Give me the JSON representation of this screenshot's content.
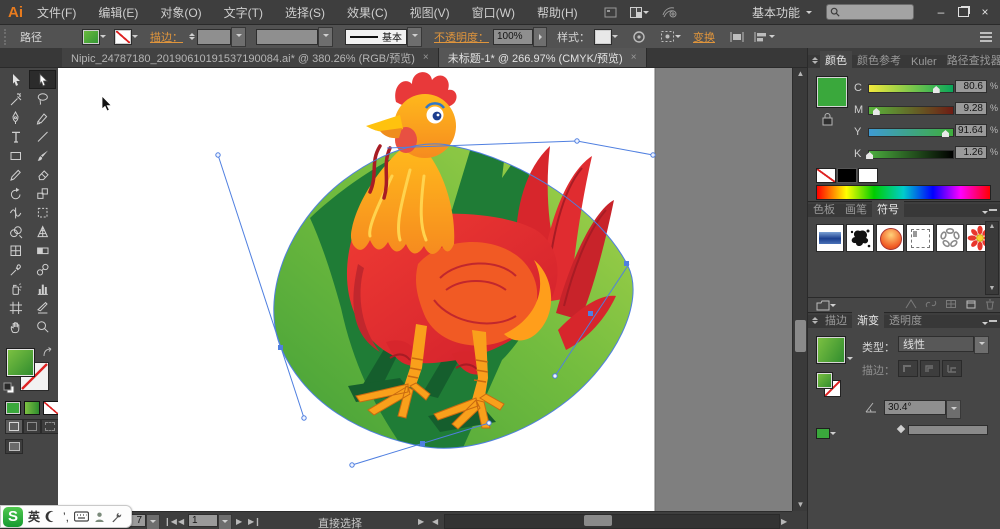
{
  "titlebar": {
    "logo": "Ai",
    "menus": [
      "文件(F)",
      "编辑(E)",
      "对象(O)",
      "文字(T)",
      "选择(S)",
      "效果(C)",
      "视图(V)",
      "窗口(W)",
      "帮助(H)"
    ],
    "workspace": "基本功能",
    "window_controls": {
      "minimize": "–",
      "restore": "restore",
      "close": "×"
    }
  },
  "optionsbar": {
    "context_label": "路径",
    "stroke_link": "描边：",
    "stroke_weight": "",
    "stroke_style": "基本",
    "opacity_link": "不透明度：",
    "opacity_value": "100%",
    "style_label": "样式：",
    "transform_link": "变换"
  },
  "tabs": [
    {
      "title": "Nipic_24787180_20190610191537190084.ai* @ 380.26% (RGB/预览)",
      "close": "×",
      "active": false
    },
    {
      "title": "未标题-1* @ 266.97% (CMYK/预览)",
      "close": "×",
      "active": true
    }
  ],
  "tools": [
    "selection",
    "direct-selection",
    "magic-wand",
    "lasso",
    "pen",
    "blob-brush",
    "type",
    "line-segment",
    "rectangle",
    "paintbrush",
    "pencil",
    "eraser",
    "rotate",
    "scale",
    "width",
    "free-transform",
    "shape-builder",
    "perspective-grid",
    "mesh",
    "gradient",
    "eyedropper",
    "blend",
    "symbol-sprayer",
    "column-graph",
    "artboard",
    "slice",
    "hand",
    "zoom"
  ],
  "active_tool": "direct-selection",
  "color_panel": {
    "tabs": [
      "颜色",
      "颜色参考",
      "Kuler",
      "路径查找器"
    ],
    "active_tab": "颜色",
    "channels": [
      {
        "label": "C",
        "value": "80.6",
        "unit": "%",
        "pos": 80.6
      },
      {
        "label": "M",
        "value": "9.28",
        "unit": "%",
        "pos": 9.28
      },
      {
        "label": "Y",
        "value": "91.64",
        "unit": "%",
        "pos": 91.64
      },
      {
        "label": "K",
        "value": "1.26",
        "unit": "%",
        "pos": 1.26
      }
    ]
  },
  "symbols_panel": {
    "tabs": [
      "色板",
      "画笔",
      "符号"
    ],
    "active_tab": "符号",
    "symbols": [
      "blue-banner",
      "ink-splat",
      "orange-orb",
      "dashed-frame",
      "gray-wreath",
      "red-daisy"
    ]
  },
  "gradient_panel": {
    "tabs": [
      "描边",
      "渐变",
      "透明度"
    ],
    "active_tab": "渐变",
    "type_label": "类型：",
    "type_value": "线性",
    "stroke_label": "描边：",
    "angle_value": "30.4°"
  },
  "statusbar": {
    "zoom_partial": "7",
    "artboard_number": "1",
    "tool_name": "直接选择"
  },
  "ime": {
    "logo": "S",
    "lang": "英",
    "punct": "’,"
  },
  "colors": {
    "ui_accent_link": "#e0953c",
    "selection_blue": "#4f7fe0",
    "current_fill_green": "#3aa83c",
    "gradient_stops": [
      "#7ec242",
      "#2e8b2e"
    ],
    "blob_light_green": "#a9d34b",
    "blob_dark_green": "#1f7c36",
    "rooster_red": "#e8242c",
    "rooster_orange": "#f7941d"
  }
}
